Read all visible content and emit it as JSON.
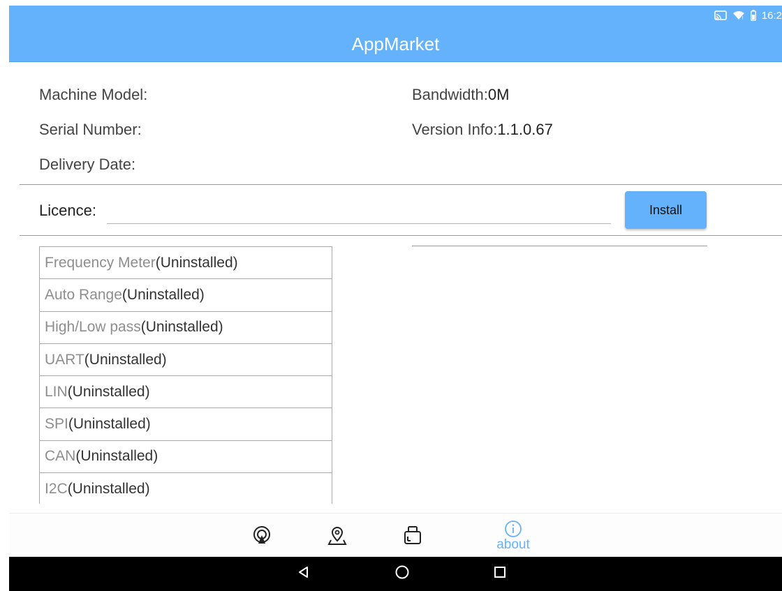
{
  "status_bar": {
    "time": "16:2",
    "icons": [
      "cast-icon",
      "wifi-icon",
      "battery-icon"
    ]
  },
  "app": {
    "title": "AppMarket"
  },
  "info": {
    "machine_model_label": "Machine Model:",
    "serial_number_label": "Serial Number:",
    "delivery_date_label": "Delivery Date:",
    "bandwidth_label": "Bandwidth:",
    "bandwidth_value": "0M",
    "version_label": "Version Info:",
    "version_value": "1.1.0.67"
  },
  "licence": {
    "label": "Licence:",
    "value": "",
    "install_label": "Install"
  },
  "plugins": [
    {
      "name": "Frequency Meter",
      "status": "(Uninstalled)"
    },
    {
      "name": "Auto Range",
      "status": "(Uninstalled)"
    },
    {
      "name": "High/Low pass",
      "status": "(Uninstalled)"
    },
    {
      "name": "UART",
      "status": "(Uninstalled)"
    },
    {
      "name": "LIN",
      "status": "(Uninstalled)"
    },
    {
      "name": "SPI",
      "status": "(Uninstalled)"
    },
    {
      "name": "CAN",
      "status": "(Uninstalled)"
    },
    {
      "name": "I2C",
      "status": "(Uninstalled)"
    }
  ],
  "bottom_nav": {
    "items": [
      "signal-icon",
      "location-icon",
      "device-icon",
      "info-icon"
    ],
    "about_label": "about",
    "active_color": "#64b2fc"
  },
  "colors": {
    "header": "#64b2fc",
    "accent": "#64b2fc",
    "system_bar": "#000000"
  },
  "system_nav": {
    "icons": [
      "back-icon",
      "home-icon",
      "recents-icon"
    ]
  }
}
